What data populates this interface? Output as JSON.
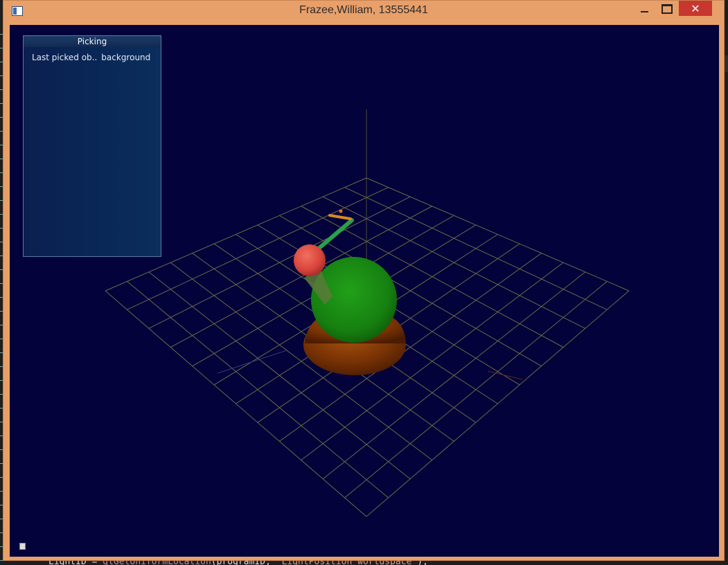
{
  "window": {
    "title": "Frazee,William, 13555441",
    "close_glyph": "✕"
  },
  "icons": {
    "app": "app-window-icon",
    "minimize": "minimize-icon",
    "maximize": "maximize-icon",
    "close": "close-icon",
    "corner": "small-square-icon"
  },
  "picking_panel": {
    "title": "Picking",
    "label": "Last picked ob..",
    "value": "background"
  },
  "background_code": {
    "line_start": "LightID = ",
    "line_fn": "glGetUniformLocation",
    "line_mid": "(programID, ",
    "line_str": "\"LightPosition_worldspace\"",
    "line_end": ");"
  },
  "colors": {
    "viewport_background": "#03023a",
    "frame": "#e8a06a",
    "grid": "#6b6a4a",
    "base": "#8a3a05",
    "sphere": "#1a8a12",
    "joint": "#e04a40",
    "arm": "#2aa04a",
    "tip": "#d88a20"
  }
}
